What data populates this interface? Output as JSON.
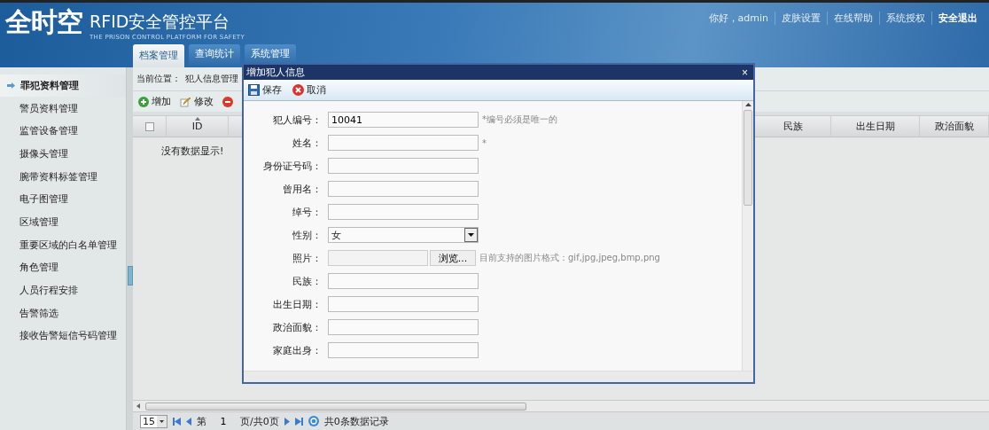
{
  "header": {
    "logo": "全时空",
    "title": "RFID安全管控平台",
    "subtitle": "THE PRISON CONTROL PLATFORM FOR SAFETY",
    "links": [
      {
        "label": "你好，admin",
        "strong": false
      },
      {
        "label": "皮肤设置",
        "strong": false
      },
      {
        "label": "在线帮助",
        "strong": false
      },
      {
        "label": "系统授权",
        "strong": false
      },
      {
        "label": "安全退出",
        "strong": true
      }
    ],
    "tabs": [
      {
        "label": "档案管理",
        "selected": true
      },
      {
        "label": "查询统计",
        "selected": false
      },
      {
        "label": "系统管理",
        "selected": false
      }
    ]
  },
  "sidebar": {
    "items": [
      {
        "label": "罪犯资料管理",
        "selected": true
      },
      {
        "label": "警员资料管理",
        "selected": false
      },
      {
        "label": "监管设备管理",
        "selected": false
      },
      {
        "label": "摄像头管理",
        "selected": false
      },
      {
        "label": "腕带资料标签管理",
        "selected": false
      },
      {
        "label": "电子图管理",
        "selected": false
      },
      {
        "label": "区域管理",
        "selected": false
      },
      {
        "label": "重要区域的白名单管理",
        "selected": false
      },
      {
        "label": "角色管理",
        "selected": false
      },
      {
        "label": "人员行程安排",
        "selected": false
      },
      {
        "label": "告警筛选",
        "selected": false
      },
      {
        "label": "接收告警短信号码管理",
        "selected": false
      }
    ]
  },
  "breadcrumb": {
    "label": "当前位置：",
    "value": "犯人信息管理"
  },
  "toolbar": [
    {
      "kind": "add",
      "label": "增加"
    },
    {
      "kind": "edit",
      "label": "修改"
    },
    {
      "kind": "delete"
    }
  ],
  "grid": {
    "columns": [
      {
        "label": "ID",
        "sorted": true
      },
      {
        "label": "民族",
        "sorted": false
      },
      {
        "label": "出生日期",
        "sorted": false
      },
      {
        "label": "政治面貌",
        "sorted": false
      }
    ],
    "select_all_checked": false,
    "empty_text": "没有数据显示!"
  },
  "pager": {
    "page_size": "15",
    "page_prefix": "第",
    "page": "1",
    "page_suffix": "页/共0页",
    "records": "共0条数据记录"
  },
  "dialog": {
    "title": "增加犯人信息",
    "close": "×",
    "buttons": [
      {
        "kind": "save",
        "label": "保存"
      },
      {
        "kind": "cancel",
        "label": "取消"
      }
    ],
    "fields": [
      {
        "kind": "text",
        "label": "犯人编号：",
        "value": "10041",
        "note": "*编号必须是唯一的"
      },
      {
        "kind": "text",
        "label": "姓名：",
        "note": "*"
      },
      {
        "kind": "text",
        "label": "身份证号码："
      },
      {
        "kind": "text",
        "label": "曾用名："
      },
      {
        "kind": "text",
        "label": "绰号："
      },
      {
        "kind": "select",
        "label": "性别：",
        "value": "女"
      },
      {
        "kind": "file",
        "label": "照片：",
        "button": "浏览...",
        "note": "目前支持的图片格式：gif,jpg,jpeg,bmp,png"
      },
      {
        "kind": "text",
        "label": "民族："
      },
      {
        "kind": "text",
        "label": "出生日期："
      },
      {
        "kind": "text",
        "label": "政治面貌："
      },
      {
        "kind": "text",
        "label": "家庭出身："
      }
    ]
  }
}
